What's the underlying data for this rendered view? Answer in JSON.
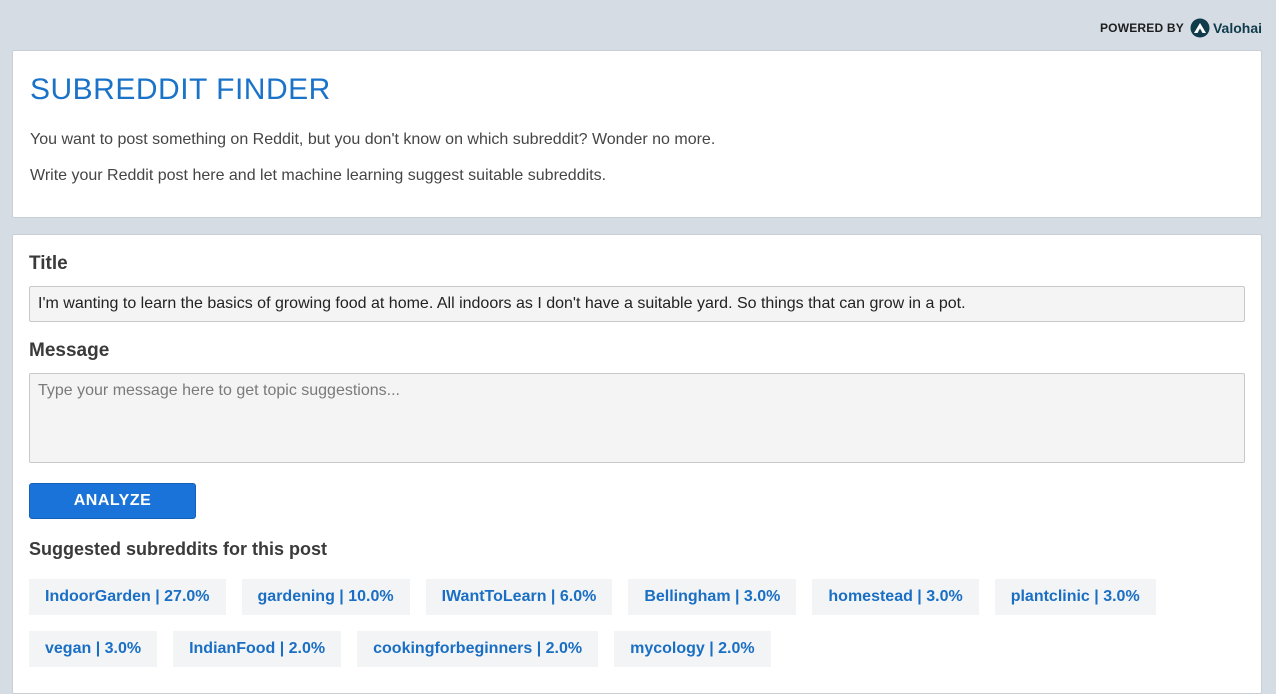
{
  "header": {
    "powered_by": "POWERED BY",
    "brand_name": "Valohai",
    "brand_icon": "valohai-logo-icon"
  },
  "intro": {
    "title": "SUBREDDIT FINDER",
    "line1": "You want to post something on Reddit, but you don't know on which subreddit? Wonder no more.",
    "line2": "Write your Reddit post here and let machine learning suggest suitable subreddits."
  },
  "form": {
    "title_label": "Title",
    "title_value": "I'm wanting to learn the basics of growing food at home. All indoors as I don't have a suitable yard. So things that can grow in a pot.",
    "message_label": "Message",
    "message_value": "",
    "message_placeholder": "Type your message here to get topic suggestions...",
    "analyze_label": "ANALYZE"
  },
  "suggestions": {
    "heading": "Suggested subreddits for this post",
    "items": [
      "IndoorGarden | 27.0%",
      "gardening | 10.0%",
      "IWantToLearn | 6.0%",
      "Bellingham | 3.0%",
      "homestead | 3.0%",
      "plantclinic | 3.0%",
      "vegan | 3.0%",
      "IndianFood | 2.0%",
      "cookingforbeginners | 2.0%",
      "mycology | 2.0%"
    ]
  },
  "colors": {
    "accent": "#1a73c9",
    "button": "#1a73d9",
    "background": "#d5dce4"
  }
}
